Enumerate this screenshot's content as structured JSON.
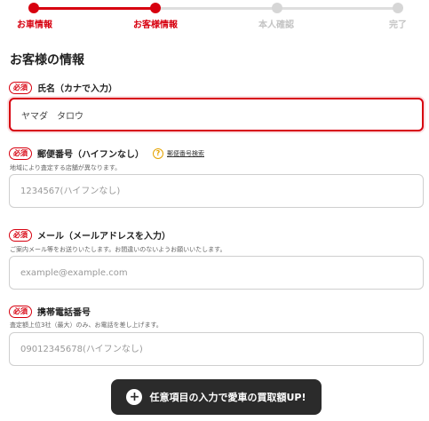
{
  "stepper": {
    "steps": [
      {
        "label": "お車情報",
        "state": "done"
      },
      {
        "label": "お客様情報",
        "state": "current"
      },
      {
        "label": "本人確認",
        "state": "todo"
      },
      {
        "label": "完了",
        "state": "todo"
      }
    ],
    "colors": {
      "active": "#d7000f",
      "inactive": "#d6d6d6"
    }
  },
  "section": {
    "title": "お客様の情報"
  },
  "fields": {
    "name": {
      "required_badge": "必須",
      "label": "氏名（カナで入力）",
      "value": "ヤマダ　タロウ",
      "placeholder": ""
    },
    "postal": {
      "required_badge": "必須",
      "label": "郵便番号（ハイフンなし）",
      "help_icon": "question-icon",
      "help_link": "郵便番号検索",
      "note": "地域により査定する店舗が異なります。",
      "value": "",
      "placeholder": "1234567(ハイフンなし)"
    },
    "email": {
      "required_badge": "必須",
      "label": "メール（メールアドレスを入力）",
      "note": "ご案内メール等をお送りいたします。お間違いのないようお願いいたします。",
      "value": "",
      "placeholder": "example@example.com"
    },
    "phone": {
      "required_badge": "必須",
      "label": "携帯電話番号",
      "note": "査定額上位3社（最大）のみ、お電話を差し上げます。",
      "value": "",
      "placeholder": "09012345678(ハイフンなし)"
    }
  },
  "banner": {
    "icon": "plus-circle-icon",
    "text": "任意項目の入力で愛車の買取額UP!"
  }
}
